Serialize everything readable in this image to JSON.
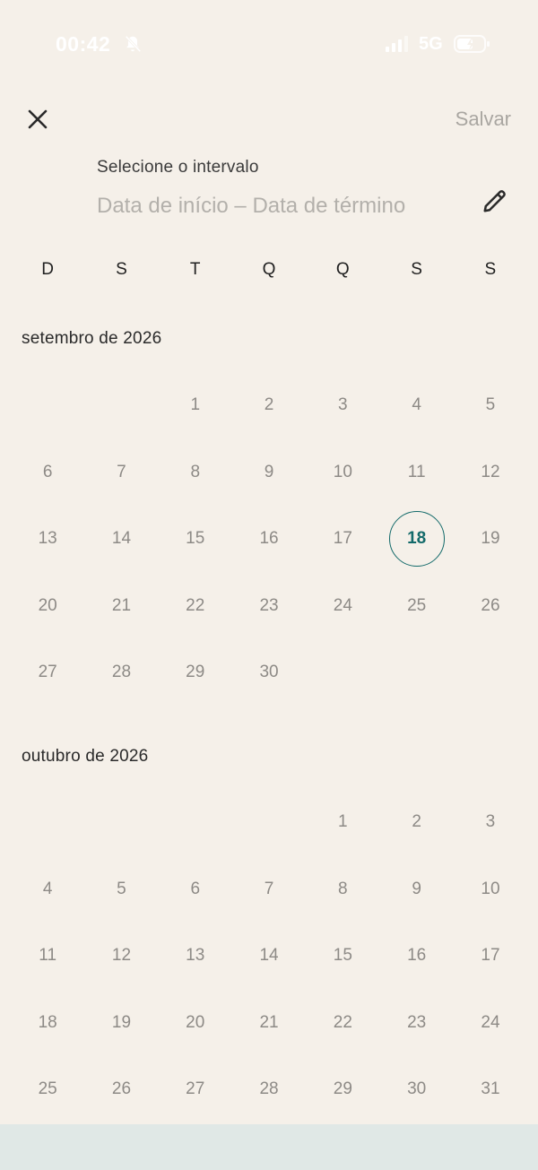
{
  "status_bar": {
    "time": "00:42",
    "network": "5G",
    "battery_level": "52"
  },
  "header": {
    "save_label": "Salvar",
    "range_label": "Selecione o intervalo",
    "range_value": "Data de início – Data de término"
  },
  "weekdays": [
    "D",
    "S",
    "T",
    "Q",
    "Q",
    "S",
    "S"
  ],
  "months": [
    {
      "title": "setembro de 2026",
      "first_weekday": 2,
      "days": 30,
      "today": 18
    },
    {
      "title": "outubro de 2026",
      "first_weekday": 4,
      "days": 31,
      "today": null
    }
  ],
  "colors": {
    "background": "#f5f0e9",
    "accent": "#136a6a",
    "muted_text": "#8d8a86",
    "bottom_strip": "#e0e8e6"
  }
}
